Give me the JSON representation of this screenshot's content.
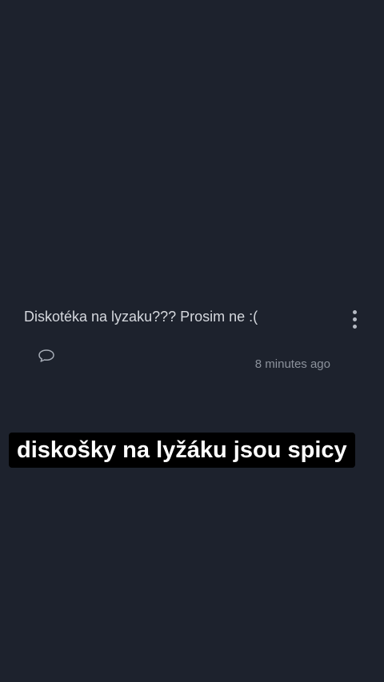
{
  "post": {
    "text": "Diskotéka na lyzaku??? Prosim ne :(",
    "timestamp": "8 minutes ago",
    "more_icon": "more-vertical-icon",
    "comment_icon": "speech-bubble-icon"
  },
  "caption": {
    "text": "diskošky na lyžáku jsou spicy"
  }
}
